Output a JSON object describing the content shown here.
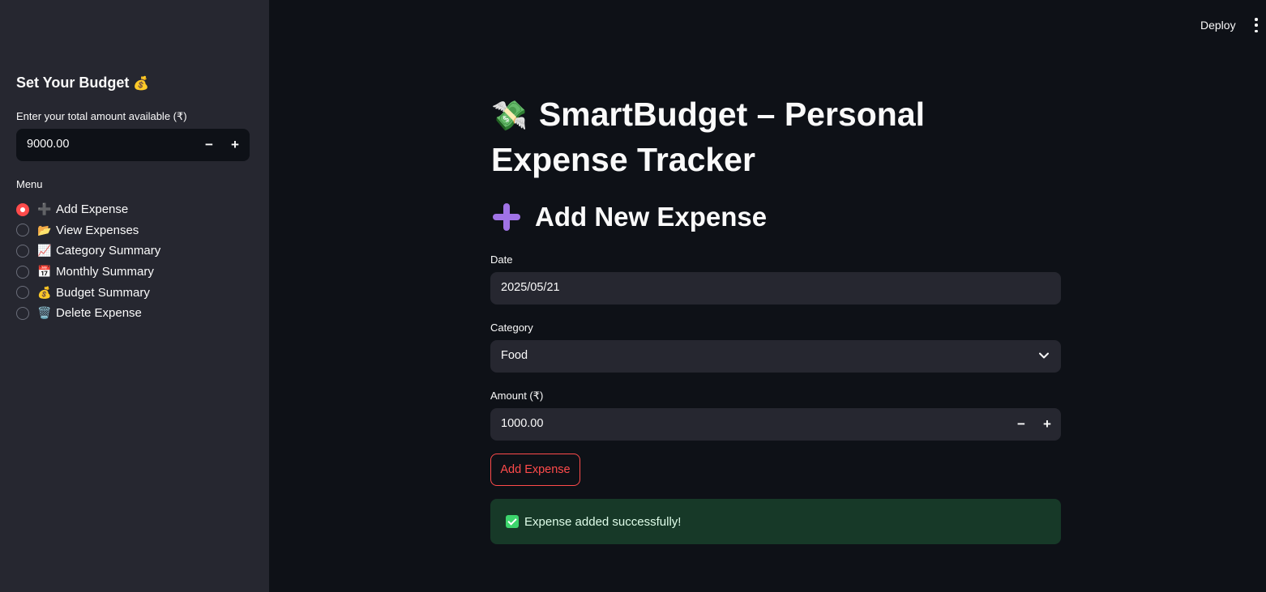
{
  "header": {
    "deploy_label": "Deploy"
  },
  "sidebar": {
    "title": "Set Your Budget",
    "title_icon": "💰",
    "budget_label": "Enter your total amount available (₹)",
    "budget_value": "9000.00",
    "decrement_label": "−",
    "increment_label": "+",
    "menu_label": "Menu",
    "menu_items": [
      {
        "icon": "➕",
        "icon_name": "plus-icon",
        "label": "Add Expense",
        "selected": true
      },
      {
        "icon": "📂",
        "icon_name": "folder-icon",
        "label": "View Expenses",
        "selected": false
      },
      {
        "icon": "📈",
        "icon_name": "chart-icon",
        "label": "Category Summary",
        "selected": false
      },
      {
        "icon": "📅",
        "icon_name": "calendar-icon",
        "label": "Monthly Summary",
        "selected": false
      },
      {
        "icon": "💰",
        "icon_name": "money-bag-icon",
        "label": "Budget Summary",
        "selected": false
      },
      {
        "icon": "🗑️",
        "icon_name": "trash-icon",
        "label": "Delete Expense",
        "selected": false
      }
    ]
  },
  "main": {
    "title_icon": "💸",
    "title": "SmartBudget – Personal Expense Tracker",
    "subtitle": "Add New Expense",
    "date_label": "Date",
    "date_value": "2025/05/21",
    "category_label": "Category",
    "category_value": "Food",
    "amount_label": "Amount (₹)",
    "amount_value": "1000.00",
    "amount_decrement": "−",
    "amount_increment": "+",
    "add_button_label": "Add Expense",
    "success_message": "Expense added successfully!"
  },
  "colors": {
    "accent": "#ff4b4b",
    "success_bg": "#173928",
    "sidebar_bg": "#262730",
    "main_bg": "#0e1117"
  }
}
